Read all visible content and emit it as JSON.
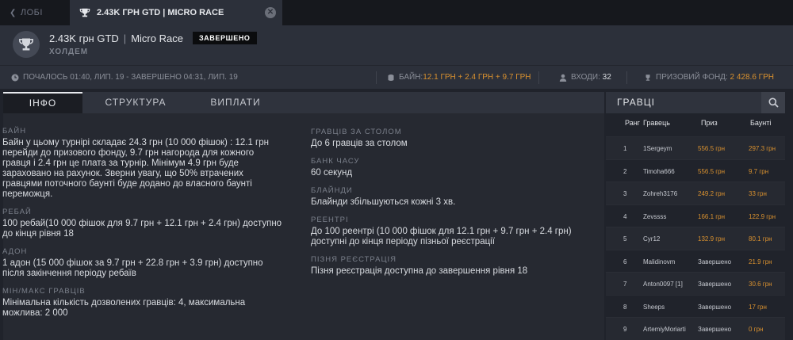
{
  "tabs": {
    "lobby": "ЛОБІ",
    "active": "2.43K ГРН GTD | MICRO RACE"
  },
  "header": {
    "title_main": "2.43K грн GTD",
    "title_sep": "|",
    "title_race": "Micro Race",
    "status": "ЗАВЕРШЕНО",
    "game": "ХОЛДЕМ"
  },
  "infobar": {
    "started": "ПОЧАЛОСЬ 01:40, ЛИП. 19 - ЗАВЕРШЕНО 04:31, ЛИП. 19",
    "buyin_label": "БАЙН:",
    "buyin_value": "12.1 ГРН + 2.4 ГРН + 9.7 ГРН",
    "entries_label": "ВХОДИ:",
    "entries_value": "32",
    "prizepool_label": "ПРИЗОВИЙ ФОНД:",
    "prizepool_value": "2 428.6 ГРН"
  },
  "subtabs": [
    "ІНФО",
    "СТРУКТУРА",
    "ВИПЛАТИ"
  ],
  "info_left": [
    {
      "label": "БАЙН",
      "text": "Байн у цьому турнірі складає 24.3 грн (10 000 фішок) : 12.1 грн\nперейди до призового фонду, 9.7 грн нагорода для кожного\nгравця і 2.4 грн це плата за турнір. Мінімум 4.9 грн буде\nзараховано на рахунок. Зверни увагу, що 50% втрачених\nгравцями поточного баунті буде додано до власного баунті\nпереможця."
    },
    {
      "label": "РЕБАЙ",
      "text": "100 ребай(10 000 фішок для 9.7 грн + 12.1 грн + 2.4 грн) доступно\nдо кінця рівня 18"
    },
    {
      "label": "АДОН",
      "text": "1 адон (15 000 фішок за 9.7 грн + 22.8 грн + 3.9 грн) доступно\nпісля закінчення періоду ребаїв"
    },
    {
      "label": "МІН/МАКС ГРАВЦІВ",
      "text": "Мінімальна кількість дозволених гравців: 4, максимальна\nможлива: 2 000"
    }
  ],
  "info_right": [
    {
      "label": "ГРАВЦІВ ЗА СТОЛОМ",
      "text": "До 6 гравців за столом"
    },
    {
      "label": "БАНК ЧАСУ",
      "text": "60 секунд"
    },
    {
      "label": "БЛАЙНДИ",
      "text": "Блайнди збільшуються кожні 3 хв."
    },
    {
      "label": "РЕЕНТРІ",
      "text": "До 100 реентрі (10 000 фішок для 12.1 грн + 9.7 грн + 2.4 грн)\nдоступні до кінця періоду пізньої реєстрації"
    },
    {
      "label": "ПІЗНЯ РЕЄСТРАЦІЯ",
      "text": "Пізня реєстрація доступна до завершення рівня 18"
    }
  ],
  "players": {
    "title": "ГРАВЦІ",
    "columns": {
      "rank": "Ранг",
      "player": "Гравець",
      "prize": "Приз",
      "bounty": "Баунті"
    },
    "rows": [
      {
        "rank": "1",
        "name": "1Sergeym",
        "prize": "556.5 грн",
        "bounty": "297.3 грн",
        "prize_done": false
      },
      {
        "rank": "2",
        "name": "Timoha666",
        "prize": "556.5 грн",
        "bounty": "9.7 грн",
        "prize_done": false
      },
      {
        "rank": "3",
        "name": "Zohreh3176",
        "prize": "249.2 грн",
        "bounty": "33 грн",
        "prize_done": false
      },
      {
        "rank": "4",
        "name": "Zevssss",
        "prize": "166.1 грн",
        "bounty": "122.9 грн",
        "prize_done": false
      },
      {
        "rank": "5",
        "name": "Cyr12",
        "prize": "132.9 грн",
        "bounty": "80.1 грн",
        "prize_done": false
      },
      {
        "rank": "6",
        "name": "Malidinovm",
        "prize": "Завершено",
        "bounty": "21.9 грн",
        "prize_done": true
      },
      {
        "rank": "7",
        "name": "Anton0097 [1]",
        "prize": "Завершено",
        "bounty": "30.6 грн",
        "prize_done": true
      },
      {
        "rank": "8",
        "name": "Sheeps",
        "prize": "Завершено",
        "bounty": "17 грн",
        "prize_done": true
      },
      {
        "rank": "9",
        "name": "ArtemiyMoriarti",
        "prize": "Завершено",
        "bounty": "0 грн",
        "prize_done": true
      }
    ]
  },
  "colors": {
    "accent": "#d9912f",
    "background": "#20232b",
    "panel": "#2c303a"
  }
}
